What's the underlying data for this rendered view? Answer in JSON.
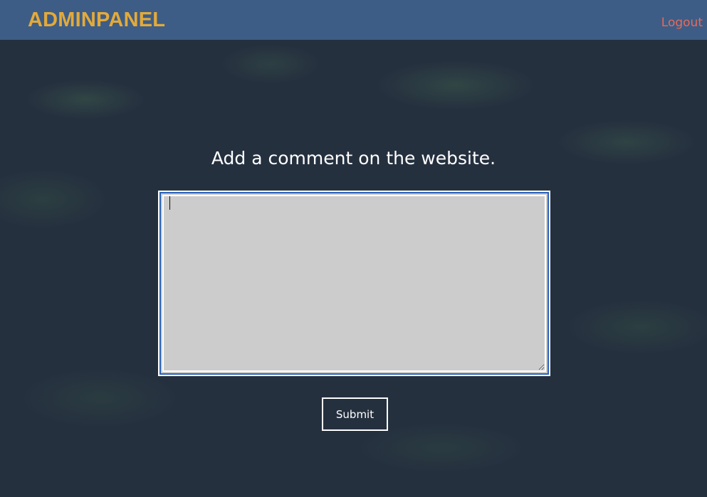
{
  "header": {
    "brand": "ADMINPANEL",
    "logout_label": "Logout"
  },
  "main": {
    "heading": "Add a comment on the website.",
    "comment": {
      "value": "",
      "placeholder": ""
    },
    "submit_label": "Submit"
  },
  "colors": {
    "navbar": "#3d5d86",
    "brand": "#e3aa3a",
    "logout": "#e86a5a",
    "background": "#25303f",
    "textarea": "#cccccc",
    "focus_ring": "#2a62b8"
  }
}
